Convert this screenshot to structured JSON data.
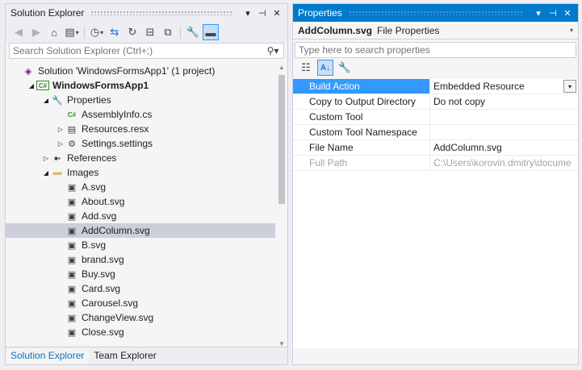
{
  "solution_explorer": {
    "title": "Solution Explorer",
    "search_placeholder": "Search Solution Explorer (Ctrl+;)",
    "tree": [
      {
        "label": "Solution 'WindowsFormsApp1' (1 project)",
        "icon": "solution-icon",
        "indent": 0,
        "expander": "",
        "bold": false
      },
      {
        "label": "WindowsFormsApp1",
        "icon": "csharp-project-icon",
        "indent": 1,
        "expander": "◢",
        "bold": true
      },
      {
        "label": "Properties",
        "icon": "wrench-icon",
        "indent": 2,
        "expander": "◢",
        "bold": false
      },
      {
        "label": "AssemblyInfo.cs",
        "icon": "csharp-file-icon",
        "indent": 3,
        "expander": "",
        "bold": false
      },
      {
        "label": "Resources.resx",
        "icon": "resx-file-icon",
        "indent": 3,
        "expander": "▷",
        "bold": false
      },
      {
        "label": "Settings.settings",
        "icon": "gear-icon",
        "indent": 3,
        "expander": "▷",
        "bold": false
      },
      {
        "label": "References",
        "icon": "references-icon",
        "indent": 2,
        "expander": "▷",
        "bold": false
      },
      {
        "label": "Images",
        "icon": "folder-icon",
        "indent": 2,
        "expander": "◢",
        "bold": false
      },
      {
        "label": "A.svg",
        "icon": "image-file-icon",
        "indent": 3,
        "expander": "",
        "bold": false
      },
      {
        "label": "About.svg",
        "icon": "image-file-icon",
        "indent": 3,
        "expander": "",
        "bold": false
      },
      {
        "label": "Add.svg",
        "icon": "image-file-icon",
        "indent": 3,
        "expander": "",
        "bold": false
      },
      {
        "label": "AddColumn.svg",
        "icon": "image-file-icon",
        "indent": 3,
        "expander": "",
        "bold": false,
        "selected": true
      },
      {
        "label": "B.svg",
        "icon": "image-file-icon",
        "indent": 3,
        "expander": "",
        "bold": false
      },
      {
        "label": "brand.svg",
        "icon": "image-file-icon",
        "indent": 3,
        "expander": "",
        "bold": false
      },
      {
        "label": "Buy.svg",
        "icon": "image-file-icon",
        "indent": 3,
        "expander": "",
        "bold": false
      },
      {
        "label": "Card.svg",
        "icon": "image-file-icon",
        "indent": 3,
        "expander": "",
        "bold": false
      },
      {
        "label": "Carousel.svg",
        "icon": "image-file-icon",
        "indent": 3,
        "expander": "",
        "bold": false
      },
      {
        "label": "ChangeView.svg",
        "icon": "image-file-icon",
        "indent": 3,
        "expander": "",
        "bold": false
      },
      {
        "label": "Close.svg",
        "icon": "image-file-icon",
        "indent": 3,
        "expander": "",
        "bold": false
      }
    ],
    "tabs": [
      "Solution Explorer",
      "Team Explorer"
    ]
  },
  "properties": {
    "title": "Properties",
    "object_name": "AddColumn.svg",
    "object_type": "File Properties",
    "search_placeholder": "Type here to search properties",
    "rows": [
      {
        "name": "Build Action",
        "value": "Embedded Resource",
        "selected": true,
        "readonly": false,
        "dropdown": true
      },
      {
        "name": "Copy to Output Directory",
        "value": "Do not copy",
        "selected": false,
        "readonly": false,
        "dropdown": false
      },
      {
        "name": "Custom Tool",
        "value": "",
        "selected": false,
        "readonly": false,
        "dropdown": false
      },
      {
        "name": "Custom Tool Namespace",
        "value": "",
        "selected": false,
        "readonly": false,
        "dropdown": false
      },
      {
        "name": "File Name",
        "value": "AddColumn.svg",
        "selected": false,
        "readonly": false,
        "dropdown": false
      },
      {
        "name": "Full Path",
        "value": "C:\\Users\\korovin.dmitry\\docume",
        "selected": false,
        "readonly": true,
        "dropdown": false
      }
    ]
  },
  "colors": {
    "accent": "#007acc",
    "selection": "#3399ff",
    "tree_selection": "#cccedb"
  }
}
